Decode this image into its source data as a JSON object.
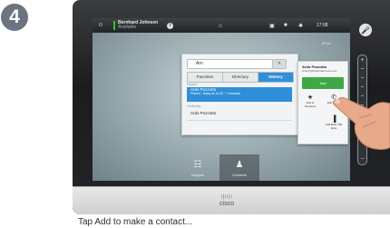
{
  "step": {
    "number": "4"
  },
  "topbar": {
    "user_name": "Bernhard Johnsen",
    "user_status": "Available",
    "time": "17:08"
  },
  "screen": {
    "call_timer": "00:11"
  },
  "contacts": {
    "search_value": "Arn",
    "tabs": [
      {
        "label": "Favorites"
      },
      {
        "label": "Directory"
      },
      {
        "label": "History"
      }
    ],
    "sections": [
      {
        "label": "Missed"
      },
      {
        "label": "Yesterday"
      }
    ],
    "rows": [
      {
        "name": "Ardo Pozzotto",
        "sub": "Placed · today at 14:30 · 7 seconds"
      },
      {
        "name": "Ardo Pozzotto",
        "sub": ""
      }
    ]
  },
  "detail": {
    "name": "Ardo Pozzotto",
    "address": "Ardo.P@therendezvous.com",
    "add_label": "Add",
    "actions": [
      {
        "label": "Add to Favorites",
        "icon": "star-icon"
      },
      {
        "label": "Edit & Call",
        "icon": "edit-call-icon"
      },
      {
        "label": "Call Rate 768 kbps",
        "icon": "signal-icon"
      }
    ]
  },
  "dock": {
    "items": [
      {
        "label": "Keypad",
        "icon": "keypad-icon"
      },
      {
        "label": "Contacts",
        "icon": "person-icon"
      }
    ]
  },
  "brand": {
    "logo_text": "cisco"
  },
  "caption": {
    "text": "Tap Add to make a contact..."
  },
  "colors": {
    "accent_blue": "#2f8fd8",
    "add_green": "#3ea845",
    "status_green": "#39c13a"
  }
}
